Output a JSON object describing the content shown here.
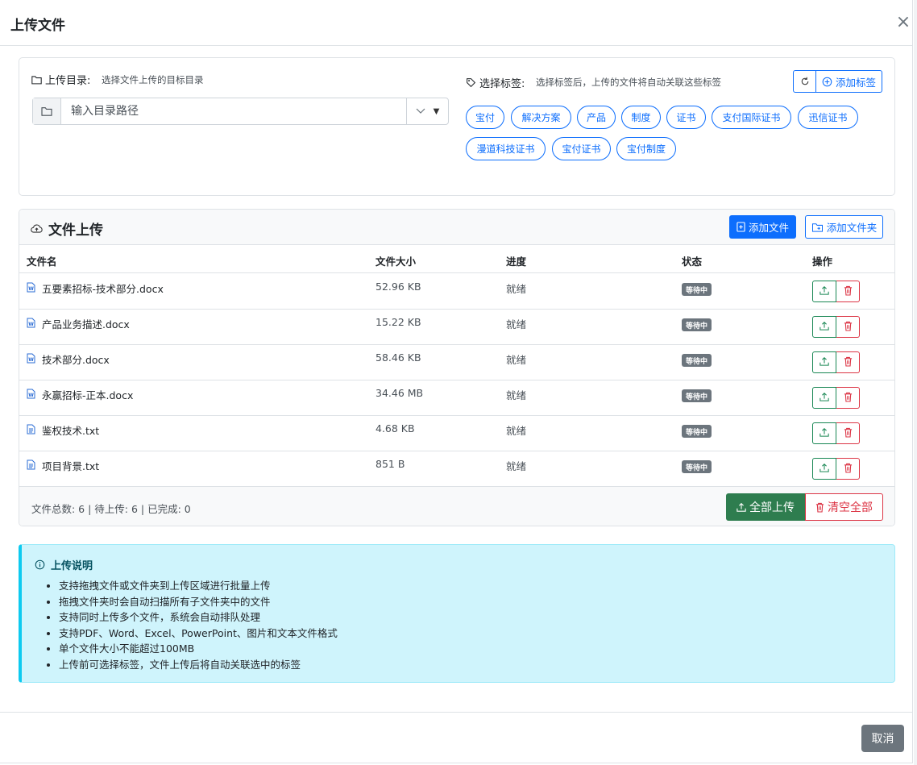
{
  "modal": {
    "title": "上传文件"
  },
  "upload_dir": {
    "label": "上传目录:",
    "hint": "选择文件上传的目标目录",
    "placeholder": "输入目录路径"
  },
  "tags": {
    "label": "选择标签:",
    "hint": "选择标签后，上传的文件将自动关联这些标签",
    "add_label": "添加标签",
    "items": [
      "宝付",
      "解决方案",
      "产品",
      "制度",
      "证书",
      "支付国际证书",
      "迅信证书",
      "漫道科技证书",
      "宝付证书",
      "宝付制度"
    ]
  },
  "files": {
    "title": "文件上传",
    "add_file": "添加文件",
    "add_folder": "添加文件夹",
    "columns": [
      "文件名",
      "文件大小",
      "进度",
      "状态",
      "操作"
    ],
    "rows": [
      {
        "name": "五要素招标-技术部分.docx",
        "size": "52.96 KB",
        "progress": "就绪",
        "status": "等待中",
        "type": "word"
      },
      {
        "name": "产品业务描述.docx",
        "size": "15.22 KB",
        "progress": "就绪",
        "status": "等待中",
        "type": "word"
      },
      {
        "name": "技术部分.docx",
        "size": "58.46 KB",
        "progress": "就绪",
        "status": "等待中",
        "type": "word"
      },
      {
        "name": "永赢招标-正本.docx",
        "size": "34.46 MB",
        "progress": "就绪",
        "status": "等待中",
        "type": "word"
      },
      {
        "name": "鉴权技术.txt",
        "size": "4.68 KB",
        "progress": "就绪",
        "status": "等待中",
        "type": "text"
      },
      {
        "name": "项目背景.txt",
        "size": "851 B",
        "progress": "就绪",
        "status": "等待中",
        "type": "text"
      }
    ],
    "stats": "文件总数: 6 | 待上传: 6 | 已完成: 0",
    "upload_all": "全部上传",
    "clear_all": "清空全部"
  },
  "info": {
    "title": "上传说明",
    "items": [
      "支持拖拽文件或文件夹到上传区域进行批量上传",
      "拖拽文件夹时会自动扫描所有子文件夹中的文件",
      "支持同时上传多个文件，系统会自动排队处理",
      "支持PDF、Word、Excel、PowerPoint、图片和文本文件格式",
      "单个文件大小不能超过100MB",
      "上传前可选择标签，文件上传后将自动关联选中的标签"
    ]
  },
  "footer": {
    "cancel": "取消"
  },
  "colors": {
    "primary": "#0d6efd",
    "success": "#2e7d4f",
    "danger": "#dc3545",
    "secondary": "#6c757d",
    "info_bg": "#cff4fc"
  }
}
